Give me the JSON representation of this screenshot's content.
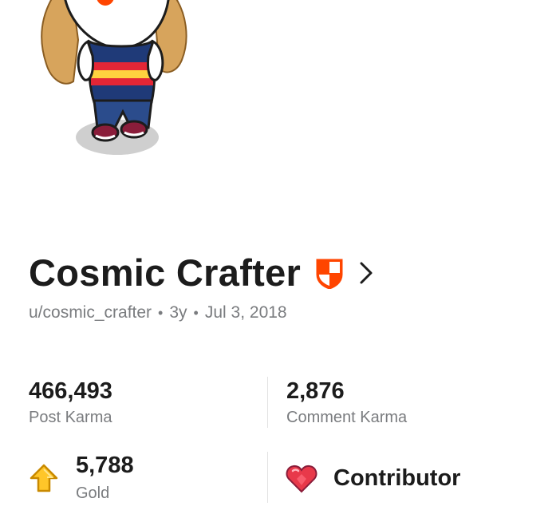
{
  "profile": {
    "display_name": "Cosmic Crafter",
    "username": "u/cosmic_crafter",
    "separator": "•",
    "age": "3y",
    "cake_day": "Jul 3, 2018"
  },
  "stats": {
    "post_karma_value": "466,493",
    "post_karma_label": "Post Karma",
    "comment_karma_value": "2,876",
    "comment_karma_label": "Comment Karma",
    "gold_value": "5,788",
    "gold_label": "Gold",
    "achievement_label": "Contributor"
  },
  "icons": {
    "avatar": "snoo-avatar",
    "shield": "shield-icon",
    "chevron": "chevron-right-icon",
    "gold": "gold-arrow-icon",
    "heart": "heart-icon"
  },
  "colors": {
    "shield_orange": "#ff4500",
    "gold_yellow": "#ffc629",
    "heart_red": "#e8394a"
  }
}
